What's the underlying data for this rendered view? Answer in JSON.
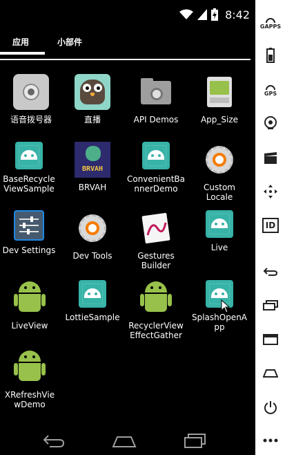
{
  "status_bar": {
    "time": "8:42"
  },
  "tabs": [
    {
      "label": "应用"
    },
    {
      "label": "小部件"
    }
  ],
  "apps": [
    {
      "label": "语音拨号器",
      "icon": "voice-dialer-icon"
    },
    {
      "label": "直播",
      "icon": "owl-icon"
    },
    {
      "label": "API Demos",
      "icon": "folder-gear-icon"
    },
    {
      "label": "App_Size",
      "icon": "android-box-icon"
    },
    {
      "label": "BaseRecycle\nViewSample",
      "icon": "android-teal-icon"
    },
    {
      "label": "BRVAH",
      "icon": "brvah-icon"
    },
    {
      "label": "ConvenientBa\nnnerDemo",
      "icon": "android-teal-icon"
    },
    {
      "label": "Custom\nLocale",
      "icon": "gear-icon"
    },
    {
      "label": "Dev Settings",
      "icon": "sliders-icon"
    },
    {
      "label": "Dev Tools",
      "icon": "gear-icon"
    },
    {
      "label": "Gestures\nBuilder",
      "icon": "gestures-icon"
    },
    {
      "label": "Live",
      "icon": "android-teal-icon"
    },
    {
      "label": "LiveView",
      "icon": "android-green-icon"
    },
    {
      "label": "LottieSample",
      "icon": "android-teal-icon"
    },
    {
      "label": "RecyclerView\nEffectGather",
      "icon": "android-green-icon"
    },
    {
      "label": "SplashOpenA\npp",
      "icon": "android-teal-icon"
    },
    {
      "label": "XRefreshVie\nwDemo",
      "icon": "android-green-icon"
    }
  ],
  "sidebar": {
    "gapps_label": "GAPPS",
    "gps_label": "GPS",
    "id_label": "ID"
  },
  "colors": {
    "teal": "#37b3a7",
    "android_green": "#97c14a",
    "orange": "#f57c00"
  }
}
